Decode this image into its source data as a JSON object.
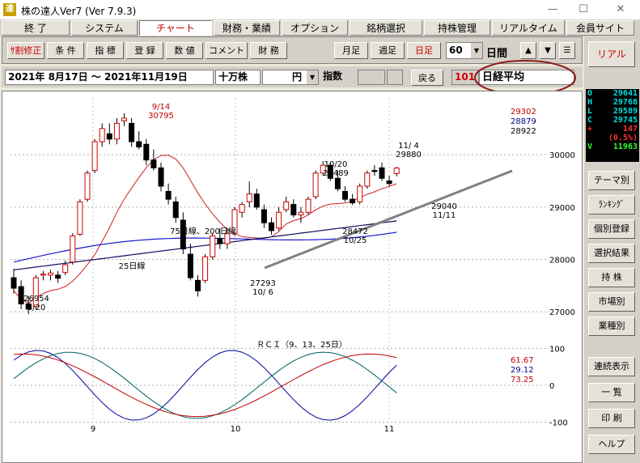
{
  "window": {
    "title": "株の達人Ver7 (Ver 7.9.3)",
    "icon": "達",
    "minimize": "—",
    "maximize": "☐",
    "close": "✕"
  },
  "menu": [
    {
      "label": "終 了",
      "active": false
    },
    {
      "label": "システム",
      "active": false
    },
    {
      "label": "チャート",
      "active": true
    },
    {
      "label": "財務・業績",
      "active": false
    },
    {
      "label": "オプション",
      "active": false
    },
    {
      "label": "銘柄選択",
      "active": false
    },
    {
      "label": "持株管理",
      "active": false
    },
    {
      "label": "リアルタイム",
      "active": false
    },
    {
      "label": "会員サイト",
      "active": false
    }
  ],
  "toolbar": {
    "buttons": [
      "ｻ割修正",
      "条 件",
      "指 標",
      "登 録",
      "数 値",
      "コメント",
      "財 務"
    ],
    "freq": [
      "月足",
      "週足",
      "日足"
    ],
    "active_freq": "日足",
    "period_value": "60",
    "period_label": "日間",
    "up": "▲",
    "down": "▼",
    "menu": "☰"
  },
  "info": {
    "date_range": "2021年 8月17日 ～ 2021年11月19日",
    "unit": "十万株",
    "currency": "円",
    "kind": "指数",
    "back": "戻る",
    "code": "101",
    "name": "日経平均"
  },
  "ohlc": [
    {
      "k": "O",
      "v": "29641",
      "c": "#00e0e0"
    },
    {
      "k": "H",
      "v": "29768",
      "c": "#00e0e0"
    },
    {
      "k": "L",
      "v": "29589",
      "c": "#00e0e0"
    },
    {
      "k": "C",
      "v": "29745",
      "c": "#00e0e0"
    },
    {
      "k": "+",
      "v": "147",
      "c": "#ff3030"
    },
    {
      "k": "",
      "v": "(0.5%)",
      "c": "#ff3030"
    },
    {
      "k": "V",
      "v": "11963",
      "c": "#30ff30"
    }
  ],
  "right_buttons": [
    "リアル",
    "テーマ別",
    "ﾗﾝｷﾝｸﾞ",
    "個別登録",
    "選択結果",
    "持 株",
    "市場別",
    "業種別",
    "連続表示",
    "一 覧",
    "印 刷",
    "ヘルプ"
  ],
  "chart_data": {
    "type": "candlestick",
    "price_axis": {
      "ticks": [
        30000,
        29000,
        28000,
        27000
      ],
      "range": [
        26600,
        30900
      ]
    },
    "rci_axis": {
      "ticks": [
        100,
        0,
        -100
      ],
      "range": [
        -110,
        110
      ]
    },
    "months": [
      "9",
      "10",
      "11"
    ],
    "ma_values": {
      "ma25": "29302",
      "ma75": "28879",
      "ma200": "28922"
    },
    "rci_values": {
      "r9": "61.67",
      "r13": "29.12",
      "r25": "73.25"
    },
    "rci_title": "ＲＣＩ（9、13、25日）",
    "annotations": [
      {
        "text": "9/14",
        "c": "#c00000"
      },
      {
        "text": "30795",
        "c": "#c00000"
      },
      {
        "text": "10/20"
      },
      {
        "text": "29489"
      },
      {
        "text": "11/ 4"
      },
      {
        "text": "29880"
      },
      {
        "text": "28472"
      },
      {
        "text": "10/25"
      },
      {
        "text": "29040"
      },
      {
        "text": "11/11"
      },
      {
        "text": "27293"
      },
      {
        "text": "10/ 6"
      },
      {
        "text": "26954"
      },
      {
        "text": "8/20"
      },
      {
        "text": "75日線、200日線"
      },
      {
        "text": "25日線"
      }
    ],
    "candles": [
      {
        "o": 27650,
        "h": 27820,
        "l": 27350,
        "c": 27450
      },
      {
        "o": 27480,
        "h": 27600,
        "l": 27050,
        "c": 27150
      },
      {
        "o": 27150,
        "h": 27300,
        "l": 26954,
        "c": 27050
      },
      {
        "o": 27100,
        "h": 27700,
        "l": 27050,
        "c": 27650
      },
      {
        "o": 27700,
        "h": 27780,
        "l": 27600,
        "c": 27720
      },
      {
        "o": 27700,
        "h": 27800,
        "l": 27600,
        "c": 27740
      },
      {
        "o": 27700,
        "h": 27780,
        "l": 27550,
        "c": 27640
      },
      {
        "o": 27750,
        "h": 27980,
        "l": 27700,
        "c": 27900
      },
      {
        "o": 27950,
        "h": 28500,
        "l": 27900,
        "c": 28450
      },
      {
        "o": 28480,
        "h": 29150,
        "l": 28450,
        "c": 29100
      },
      {
        "o": 29150,
        "h": 29700,
        "l": 29100,
        "c": 29650
      },
      {
        "o": 29700,
        "h": 30300,
        "l": 29650,
        "c": 30250
      },
      {
        "o": 30250,
        "h": 30600,
        "l": 30150,
        "c": 30500
      },
      {
        "o": 30400,
        "h": 30600,
        "l": 30200,
        "c": 30300
      },
      {
        "o": 30300,
        "h": 30700,
        "l": 30200,
        "c": 30600
      },
      {
        "o": 30650,
        "h": 30795,
        "l": 30550,
        "c": 30700
      },
      {
        "o": 30600,
        "h": 30700,
        "l": 30150,
        "c": 30250
      },
      {
        "o": 30250,
        "h": 30450,
        "l": 30100,
        "c": 30150
      },
      {
        "o": 30200,
        "h": 30300,
        "l": 29800,
        "c": 29900
      },
      {
        "o": 29900,
        "h": 30100,
        "l": 29700,
        "c": 29750
      },
      {
        "o": 29750,
        "h": 29850,
        "l": 29300,
        "c": 29400
      },
      {
        "o": 29300,
        "h": 29450,
        "l": 29050,
        "c": 29150
      },
      {
        "o": 29100,
        "h": 29200,
        "l": 28700,
        "c": 28800
      },
      {
        "o": 28750,
        "h": 28900,
        "l": 28100,
        "c": 28200
      },
      {
        "o": 28100,
        "h": 28300,
        "l": 27600,
        "c": 27650
      },
      {
        "o": 27600,
        "h": 27700,
        "l": 27293,
        "c": 27400
      },
      {
        "o": 27600,
        "h": 28100,
        "l": 27550,
        "c": 28050
      },
      {
        "o": 28050,
        "h": 28500,
        "l": 28000,
        "c": 28450
      },
      {
        "o": 28400,
        "h": 28600,
        "l": 28200,
        "c": 28300
      },
      {
        "o": 28300,
        "h": 28600,
        "l": 28200,
        "c": 28500
      },
      {
        "o": 28500,
        "h": 29000,
        "l": 28450,
        "c": 28950
      },
      {
        "o": 28900,
        "h": 29100,
        "l": 28800,
        "c": 29050
      },
      {
        "o": 29100,
        "h": 29489,
        "l": 29000,
        "c": 29250
      },
      {
        "o": 29250,
        "h": 29350,
        "l": 28950,
        "c": 29000
      },
      {
        "o": 28950,
        "h": 29050,
        "l": 28600,
        "c": 28700
      },
      {
        "o": 28700,
        "h": 28800,
        "l": 28472,
        "c": 28550
      },
      {
        "o": 28600,
        "h": 29000,
        "l": 28550,
        "c": 28900
      },
      {
        "o": 28950,
        "h": 29200,
        "l": 28900,
        "c": 29100
      },
      {
        "o": 29050,
        "h": 29150,
        "l": 28800,
        "c": 28850
      },
      {
        "o": 28850,
        "h": 29000,
        "l": 28700,
        "c": 28900
      },
      {
        "o": 28900,
        "h": 29200,
        "l": 28850,
        "c": 29150
      },
      {
        "o": 29200,
        "h": 29700,
        "l": 29150,
        "c": 29650
      },
      {
        "o": 29650,
        "h": 29880,
        "l": 29600,
        "c": 29800
      },
      {
        "o": 29800,
        "h": 29850,
        "l": 29500,
        "c": 29550
      },
      {
        "o": 29550,
        "h": 29700,
        "l": 29300,
        "c": 29350
      },
      {
        "o": 29300,
        "h": 29400,
        "l": 29100,
        "c": 29150
      },
      {
        "o": 29150,
        "h": 29250,
        "l": 29040,
        "c": 29080
      },
      {
        "o": 29100,
        "h": 29450,
        "l": 29050,
        "c": 29400
      },
      {
        "o": 29400,
        "h": 29700,
        "l": 29350,
        "c": 29650
      },
      {
        "o": 29700,
        "h": 29800,
        "l": 29600,
        "c": 29680
      },
      {
        "o": 29750,
        "h": 29850,
        "l": 29500,
        "c": 29550
      },
      {
        "o": 29500,
        "h": 29600,
        "l": 29400,
        "c": 29450
      },
      {
        "o": 29641,
        "h": 29768,
        "l": 29589,
        "c": 29745
      }
    ]
  }
}
